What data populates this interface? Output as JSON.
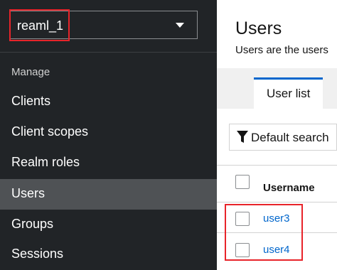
{
  "realm": {
    "selected": "reaml_1"
  },
  "sidebar": {
    "section_title": "Manage",
    "items": [
      {
        "label": "Clients"
      },
      {
        "label": "Client scopes"
      },
      {
        "label": "Realm roles"
      },
      {
        "label": "Users",
        "active": true
      },
      {
        "label": "Groups"
      },
      {
        "label": "Sessions"
      }
    ]
  },
  "main": {
    "title": "Users",
    "subtitle": "Users are the users",
    "tabs": [
      {
        "label": "User list"
      }
    ],
    "search_label": "Default search",
    "table": {
      "columns": [
        "Username"
      ],
      "rows": [
        {
          "username": "user3"
        },
        {
          "username": "user4"
        }
      ]
    }
  },
  "colors": {
    "sidebar_bg": "#212427",
    "active_bg": "#4f5255",
    "link": "#0066cc",
    "highlight": "#e8242a"
  }
}
